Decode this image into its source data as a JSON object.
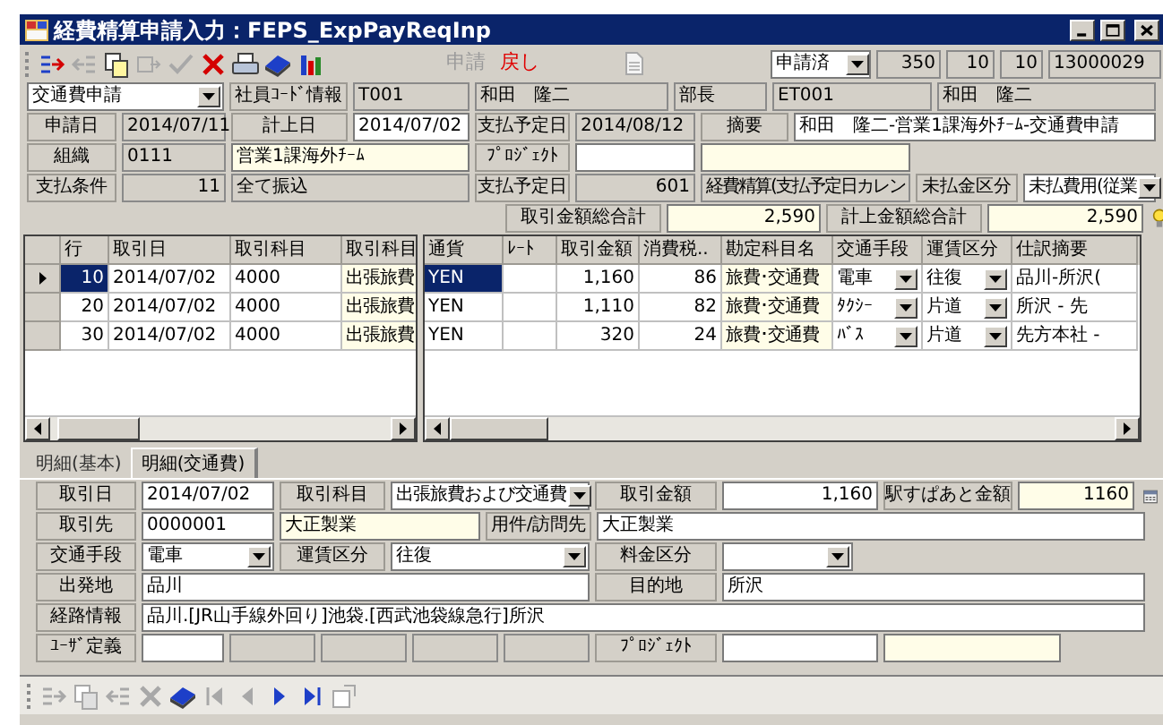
{
  "window": {
    "title": "経費精算申請入力：FEPS_ExpPayReqInp"
  },
  "toolbar": {
    "tools": [
      {
        "kind": "add_row",
        "disabled": false
      },
      {
        "kind": "remove_row",
        "disabled": true
      },
      {
        "kind": "copy",
        "disabled": false
      },
      {
        "kind": "move",
        "disabled": true
      },
      {
        "kind": "check",
        "disabled": true
      },
      {
        "kind": "delete",
        "disabled": false
      },
      {
        "kind": "print",
        "disabled": false
      },
      {
        "kind": "book",
        "disabled": false
      },
      {
        "kind": "chart",
        "disabled": false
      }
    ],
    "actions": [
      {
        "label": "申請",
        "disabled": true
      },
      {
        "label": "戻し",
        "disabled": false
      }
    ],
    "status": {
      "value": "申請済"
    },
    "counters": [
      "350",
      "10",
      "10",
      "13000029"
    ]
  },
  "header_form": {
    "lines": [
      {
        "fields": [
          {
            "kind": "dropdown",
            "value": "交通費申請"
          },
          {
            "kind": "label",
            "text": "社員ｺｰﾄﾞ情報"
          },
          {
            "kind": "readonly",
            "value": "T001"
          },
          {
            "kind": "readonly",
            "value": "和田　隆二"
          },
          {
            "kind": "readonly",
            "value": "部長"
          },
          {
            "kind": "readonly",
            "value": "ET001"
          },
          {
            "kind": "readonly",
            "value": "和田　隆二"
          }
        ]
      },
      {
        "fields": [
          {
            "kind": "label",
            "text": "申請日"
          },
          {
            "kind": "readonly",
            "value": "2014/07/11"
          },
          {
            "kind": "label",
            "text": "計上日"
          },
          {
            "kind": "input",
            "value": "2014/07/02"
          },
          {
            "kind": "label",
            "text": "支払予定日"
          },
          {
            "kind": "readonly",
            "value": "2014/08/12"
          },
          {
            "kind": "label",
            "text": "摘要"
          },
          {
            "kind": "input",
            "value": "和田　隆二-営業1課海外ﾁｰﾑ-交通費申請"
          }
        ]
      },
      {
        "fields": [
          {
            "kind": "label",
            "text": "組織"
          },
          {
            "kind": "readonly",
            "value": "0111"
          },
          {
            "kind": "lookup",
            "value": "営業1課海外ﾁｰﾑ"
          },
          {
            "kind": "label",
            "text": "ﾌﾟﾛｼﾞｪｸﾄ"
          },
          {
            "kind": "input"
          },
          {
            "kind": "lookup"
          }
        ]
      },
      {
        "fields": [
          {
            "kind": "label",
            "text": "支払条件"
          },
          {
            "kind": "readonly",
            "value": "11"
          },
          {
            "kind": "readonly",
            "value": "全て振込"
          },
          {
            "kind": "label",
            "text": "支払予定日"
          },
          {
            "kind": "readonly",
            "value": "601"
          },
          {
            "kind": "readonly",
            "value": "経費精算(支払予定日カレン"
          },
          {
            "kind": "label",
            "text": "未払金区分"
          },
          {
            "kind": "dropdown",
            "value": "未払費用(従業"
          }
        ]
      },
      {
        "fields": [
          {
            "kind": "label",
            "text": "取引金額総合計"
          },
          {
            "kind": "lookup",
            "value": "2,590"
          },
          {
            "kind": "label",
            "text": "計上金額総合計"
          },
          {
            "kind": "lookup",
            "value": "2,590"
          },
          {
            "kind": "hint_button"
          }
        ]
      }
    ]
  },
  "left_grid": {
    "columns": [
      {
        "label": "行",
        "kind": "number"
      },
      {
        "label": "取引日",
        "kind": "text"
      },
      {
        "label": "取引科目",
        "kind": "text"
      },
      {
        "label": "取引科目",
        "kind": "lookup"
      }
    ],
    "rows": [
      {
        "selected": true,
        "cells": [
          "10",
          "2014/07/02",
          "4000",
          "出張旅費"
        ]
      },
      {
        "selected": false,
        "cells": [
          "20",
          "2014/07/02",
          "4000",
          "出張旅費"
        ]
      },
      {
        "selected": false,
        "cells": [
          "30",
          "2014/07/02",
          "4000",
          "出張旅費"
        ]
      }
    ]
  },
  "right_grid": {
    "columns": [
      {
        "label": "通貨",
        "kind": "text"
      },
      {
        "label": "ﾚｰﾄ",
        "kind": "text"
      },
      {
        "label": "取引金額",
        "kind": "number"
      },
      {
        "label": "消費税..",
        "kind": "number"
      },
      {
        "label": "勘定科目名",
        "kind": "lookup"
      },
      {
        "label": "交通手段",
        "kind": "dropdown"
      },
      {
        "label": "運賃区分",
        "kind": "dropdown"
      },
      {
        "label": "仕訳摘要",
        "kind": "text"
      }
    ],
    "rows": [
      {
        "selected": true,
        "cells": [
          "YEN",
          null,
          "1,160",
          "86",
          "旅費･交通費",
          "電車",
          "往復",
          "品川-所沢("
        ]
      },
      {
        "selected": false,
        "cells": [
          "YEN",
          null,
          "1,110",
          "82",
          "旅費･交通費",
          "ﾀｸｼｰ",
          "片道",
          "所沢 - 先"
        ]
      },
      {
        "selected": false,
        "cells": [
          "YEN",
          null,
          "320",
          "24",
          "旅費･交通費",
          "ﾊﾞｽ",
          "片道",
          "先方本社 -"
        ]
      }
    ]
  },
  "tabs": [
    {
      "label": "明細(基本)",
      "selected": false
    },
    {
      "label": "明細(交通費)",
      "selected": true
    }
  ],
  "detail_form": {
    "lines": [
      {
        "fields": [
          {
            "kind": "label",
            "text": "取引日"
          },
          {
            "kind": "input",
            "value": "2014/07/02"
          },
          {
            "kind": "label",
            "text": "取引科目"
          },
          {
            "kind": "dropdown",
            "value": "出張旅費および交通費"
          },
          {
            "kind": "label",
            "text": "取引金額"
          },
          {
            "kind": "input",
            "value": "1,160"
          },
          {
            "kind": "label",
            "text": "駅すぱあと金額"
          },
          {
            "kind": "lookup",
            "value": "1160"
          },
          {
            "kind": "calendar_button"
          }
        ]
      },
      {
        "fields": [
          {
            "kind": "label",
            "text": "取引先"
          },
          {
            "kind": "input",
            "value": "0000001"
          },
          {
            "kind": "lookup",
            "value": "大正製業"
          },
          {
            "kind": "label",
            "text": "用件/訪問先"
          },
          {
            "kind": "input",
            "value": "大正製業"
          }
        ]
      },
      {
        "fields": [
          {
            "kind": "label",
            "text": "交通手段"
          },
          {
            "kind": "dropdown",
            "value": "電車"
          },
          {
            "kind": "label",
            "text": "運賃区分"
          },
          {
            "kind": "dropdown",
            "value": "往復"
          },
          {
            "kind": "label",
            "text": "料金区分"
          },
          {
            "kind": "dropdown"
          }
        ]
      },
      {
        "fields": [
          {
            "kind": "label",
            "text": "出発地"
          },
          {
            "kind": "input",
            "value": "品川"
          },
          {
            "kind": "label",
            "text": "目的地"
          },
          {
            "kind": "input",
            "value": "所沢"
          }
        ]
      },
      {
        "fields": [
          {
            "kind": "label",
            "text": "経路情報"
          },
          {
            "kind": "input",
            "value": "品川.[JR山手線外回り]池袋.[西武池袋線急行]所沢"
          }
        ]
      },
      {
        "fields": [
          {
            "kind": "label",
            "text": "ﾕｰｻﾞ定義"
          },
          {
            "kind": "input"
          },
          {
            "kind": "readonly"
          },
          {
            "kind": "readonly"
          },
          {
            "kind": "readonly"
          },
          {
            "kind": "readonly"
          },
          {
            "kind": "label",
            "text": "ﾌﾟﾛｼﾞｪｸﾄ"
          },
          {
            "kind": "input"
          },
          {
            "kind": "lookup"
          }
        ]
      }
    ]
  },
  "bottom_toolbar": {
    "tools": [
      {
        "kind": "add_row",
        "disabled": true
      },
      {
        "kind": "copy",
        "disabled": true
      },
      {
        "kind": "remove_row",
        "disabled": true
      },
      {
        "kind": "delete",
        "disabled": true
      },
      {
        "kind": "book",
        "disabled": false
      },
      {
        "kind": "first",
        "disabled": true
      },
      {
        "kind": "prev",
        "disabled": true
      },
      {
        "kind": "next",
        "disabled": false
      },
      {
        "kind": "last",
        "disabled": false
      },
      {
        "kind": "export",
        "disabled": true
      }
    ]
  }
}
